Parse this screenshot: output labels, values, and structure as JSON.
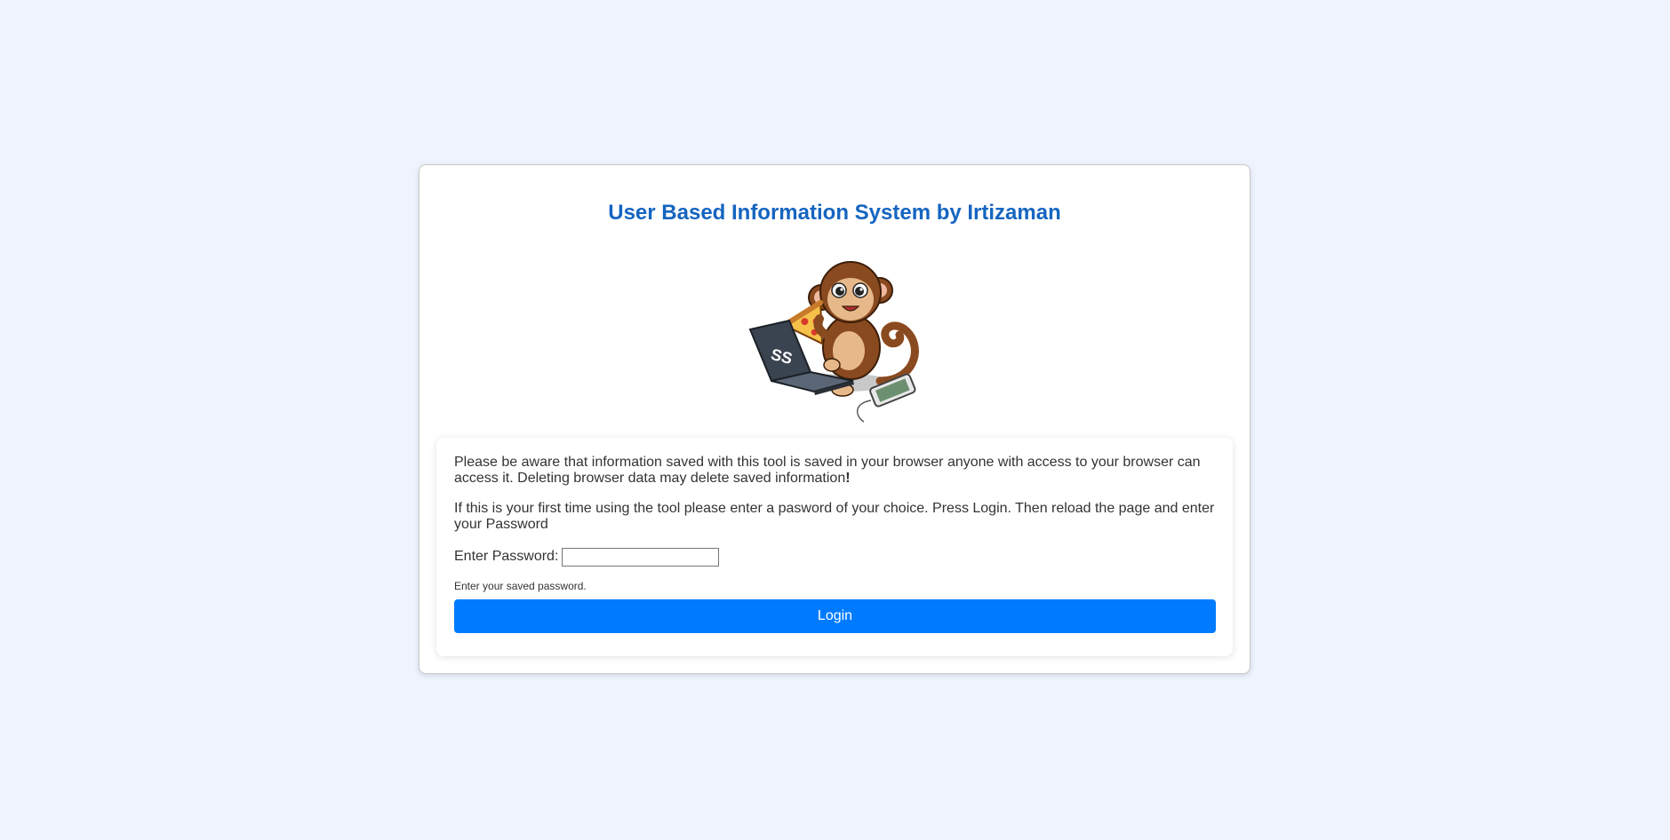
{
  "page": {
    "title": "User Based Information System by Irtizaman"
  },
  "colors": {
    "background": "#eef3fe",
    "title": "#1565c0",
    "button": "#007bff",
    "text": "#333333"
  },
  "mascot": {
    "icon": "monkey-with-laptop-and-pizza-icon",
    "laptop_text": "SS"
  },
  "notice": {
    "warning_before_bang": "Please be aware that information saved with this tool is saved in your browser anyone with access to your browser can access it. Deleting browser data may delete saved information",
    "warning_bang": "!",
    "first_time": "If this is your first time using the tool please enter a pasword of your choice. Press Login. Then reload the page and enter your Password"
  },
  "form": {
    "password_label": "Enter Password:",
    "password_value": "",
    "hint": "Enter your saved password.",
    "login_label": "Login"
  }
}
